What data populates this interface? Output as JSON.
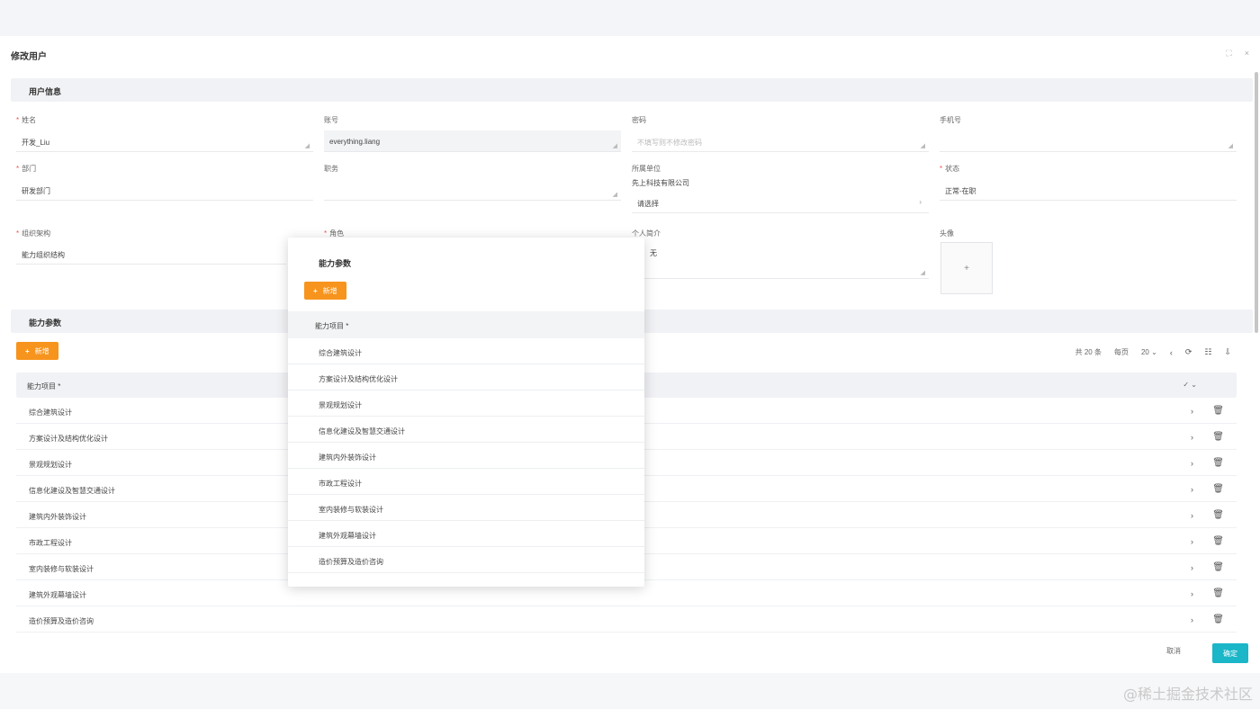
{
  "dialog": {
    "title": "修改用户",
    "fullscreen_icon": "⛶",
    "close_icon": "×"
  },
  "user_section": {
    "title": "用户信息"
  },
  "fields": {
    "name": {
      "label": "姓名",
      "value": "开发_Liu"
    },
    "account": {
      "label": "账号",
      "value": "everything.liang"
    },
    "password": {
      "label": "密码",
      "placeholder": "不填写则不修改密码"
    },
    "phone": {
      "label": "手机号",
      "value": ""
    },
    "department": {
      "label": "部门",
      "value": "研发部门"
    },
    "position": {
      "label": "职务",
      "value": ""
    },
    "org": {
      "label": "所属单位",
      "value": "先上科技有限公司",
      "select_placeholder": "请选择"
    },
    "status": {
      "label": "状态",
      "value": "正常-在职"
    },
    "org_struct": {
      "label": "组织架构",
      "value": "能力组织结构"
    },
    "role": {
      "label": "角色",
      "value": ""
    },
    "profile": {
      "label": "个人简介",
      "value": "无"
    },
    "avatar": {
      "label": "头像",
      "icon": "+"
    }
  },
  "ability_section": {
    "title": "能力参数",
    "add_label": "新增"
  },
  "pager": {
    "total": "共 20 条",
    "per_page_label": "每页",
    "per_page": "20",
    "per_page_chev": "⌄",
    "prev_icon": "‹",
    "refresh_icon": "⟳",
    "column_icon": "☷",
    "export_icon": "⇩"
  },
  "table": {
    "header": "能力项目 *",
    "sort_icon": "✓ ⌄",
    "rows": [
      "综合建筑设计",
      "方案设计及结构优化设计",
      "景观规划设计",
      "信息化建设及智慧交通设计",
      "建筑内外装饰设计",
      "市政工程设计",
      "室内装修与软装设计",
      "建筑外观幕墙设计",
      "造价预算及造价咨询"
    ],
    "row_arrow": "›",
    "delete_icon": "🗑"
  },
  "popup": {
    "title": "能力参数",
    "add_label": "新增",
    "header": "能力项目 *",
    "rows": [
      "综合建筑设计",
      "方案设计及结构优化设计",
      "景观规划设计",
      "信息化建设及智慧交通设计",
      "建筑内外装饰设计",
      "市政工程设计",
      "室内装修与软装设计",
      "建筑外观幕墙设计",
      "造价预算及造价咨询"
    ]
  },
  "footer": {
    "cancel_label": "取消",
    "ok_label": "确定"
  },
  "watermark": "@稀土掘金技术社区",
  "colors": {
    "accent_orange": "#f7941d",
    "primary_teal": "#1bb6c8"
  }
}
